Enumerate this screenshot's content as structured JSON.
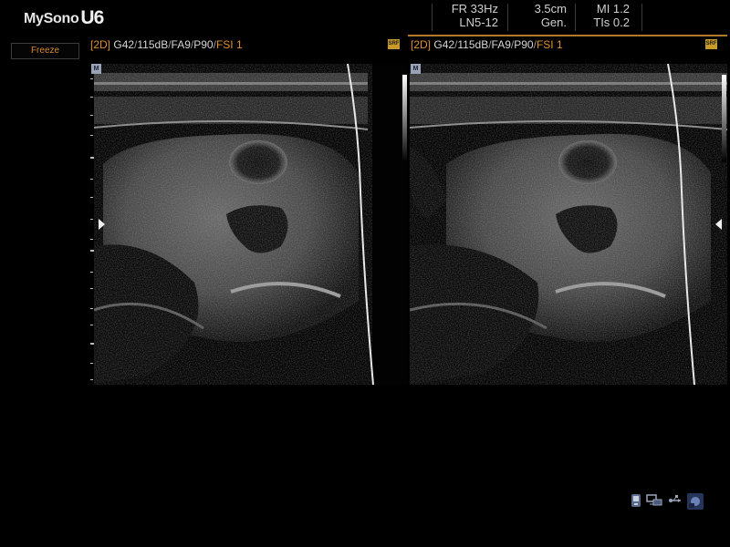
{
  "header": {
    "logo_text": "MySono",
    "logo_model": "U6",
    "frame_rate": "FR 33Hz",
    "probe": "LN5-12",
    "depth": "3.5cm",
    "preset": "Gen.",
    "mi": "MI 1.2",
    "tis": "TIs 0.2"
  },
  "left_panel": {
    "freeze_label": "Freeze"
  },
  "panels": [
    {
      "mode": "[2D]",
      "gain": "G42",
      "dynamic_range": "115dB",
      "frame_avg": "FA9",
      "power": "P90",
      "fsi": "FSI 1",
      "sep": "/",
      "srf_badge": "SRF",
      "m_marker": "M"
    },
    {
      "mode": "[2D]",
      "gain": "G42",
      "dynamic_range": "115dB",
      "frame_avg": "FA9",
      "power": "P90",
      "fsi": "FSI 1",
      "sep": "/",
      "srf_badge": "SRF",
      "m_marker": "M"
    }
  ],
  "colors": {
    "accent": "#e08f2b",
    "freeze_text": "#d88a2e",
    "srf_badge": "#c79a2a"
  },
  "status_icons": [
    "probe-icon",
    "network-icon",
    "usb-icon",
    "dicom-icon"
  ]
}
